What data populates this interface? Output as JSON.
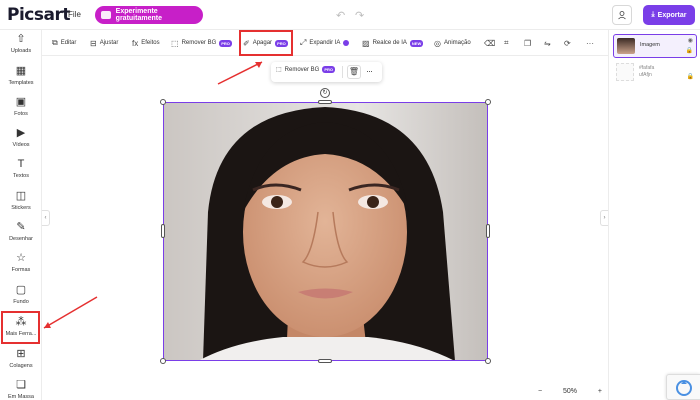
{
  "topbar": {
    "logo": "Picsart",
    "file_menu": "File",
    "trial_button": "Experimente gratuitamente",
    "export_button": "Exportar"
  },
  "sidebar": {
    "items": [
      {
        "label": "Uploads",
        "icon": "upload-icon"
      },
      {
        "label": "Templates",
        "icon": "templates-icon"
      },
      {
        "label": "Fotos",
        "icon": "photos-icon"
      },
      {
        "label": "Vídeos",
        "icon": "videos-icon"
      },
      {
        "label": "Textos",
        "icon": "text-icon"
      },
      {
        "label": "Stickers",
        "icon": "sticker-icon"
      },
      {
        "label": "Desenhar",
        "icon": "brush-icon"
      },
      {
        "label": "Formas",
        "icon": "star-icon"
      },
      {
        "label": "Fundo",
        "icon": "background-icon"
      },
      {
        "label": "Mais Ferra...",
        "icon": "more-tools-icon"
      },
      {
        "label": "Colagens",
        "icon": "collage-icon"
      },
      {
        "label": "Em Massa",
        "icon": "batch-icon"
      }
    ]
  },
  "toolbar": {
    "tools": [
      {
        "label": "Editar",
        "icon": "edit-icon"
      },
      {
        "label": "Ajustar",
        "icon": "adjust-icon"
      },
      {
        "label": "Efeitos",
        "icon": "effects-icon"
      },
      {
        "label": "Remover BG",
        "icon": "remove-bg-icon",
        "badge": "PRO"
      },
      {
        "label": "Apagar",
        "icon": "eraser-icon",
        "badge": "PRO"
      },
      {
        "label": "Expandir IA",
        "icon": "expand-icon"
      },
      {
        "label": "Realce de IA",
        "icon": "enhance-icon",
        "badge": "NEW"
      },
      {
        "label": "Animação",
        "icon": "animation-icon"
      }
    ]
  },
  "context_toolbar": {
    "remove_bg_label": "Remover BG",
    "remove_bg_badge": "PRO"
  },
  "zoom": {
    "minus": "−",
    "value": "50%",
    "plus": "+"
  },
  "layers": {
    "selected_name": "Imagem",
    "second_line1": "#fafafa",
    "second_line2": "ufAfjn"
  },
  "colors": {
    "accent": "#7a3ee8",
    "trial": "#c71fc8",
    "highlight": "#e53030"
  }
}
